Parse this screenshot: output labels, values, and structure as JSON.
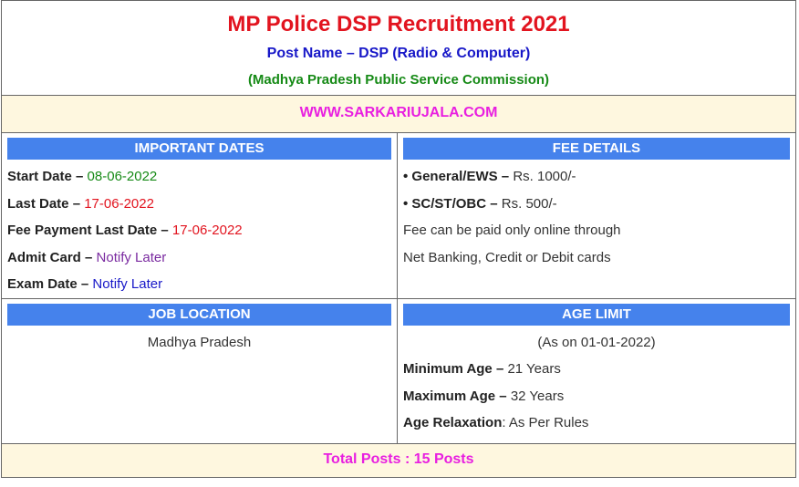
{
  "header": {
    "title": "MP Police DSP Recruitment 2021",
    "post_name": "Post Name – DSP (Radio & Computer)",
    "organization": "(Madhya Pradesh Public Service Commission)"
  },
  "website": "WWW.SARKARIUJALA.COM",
  "important_dates": {
    "heading": "IMPORTANT DATES",
    "start_label": "Start Date –",
    "start_value": "08-06-2022",
    "last_label": "Last Date –",
    "last_value": "17-06-2022",
    "fee_label": "Fee Payment Last Date –",
    "fee_value": "17-06-2022",
    "admit_label": "Admit Card –",
    "admit_value": "Notify Later",
    "exam_label": "Exam Date –",
    "exam_value": "Notify Later"
  },
  "fee_details": {
    "heading": "FEE DETAILS",
    "general_label": "• General/EWS –",
    "general_value": "Rs. 1000/-",
    "reserved_label": "• SC/ST/OBC –",
    "reserved_value": "Rs. 500/-",
    "note_line1": "Fee can be paid only online through",
    "note_line2": "Net Banking, Credit or Debit cards"
  },
  "job_location": {
    "heading": "JOB LOCATION",
    "value": "Madhya Pradesh"
  },
  "age_limit": {
    "heading": "AGE LIMIT",
    "as_on": "(As on 01-01-2022)",
    "min_label": "Minimum Age –",
    "min_value": "21 Years",
    "max_label": "Maximum Age –",
    "max_value": "32 Years",
    "relax_label": "Age Relaxation",
    "relax_value": ": As Per Rules"
  },
  "total_posts": "Total Posts : 15 Posts",
  "colors": {
    "title_red": "#e2141f",
    "post_blue": "#1818c8",
    "org_green": "#168a16",
    "band_bg": "#fef7df",
    "band_text": "#e81fe0",
    "header_blue": "#4582ec"
  }
}
